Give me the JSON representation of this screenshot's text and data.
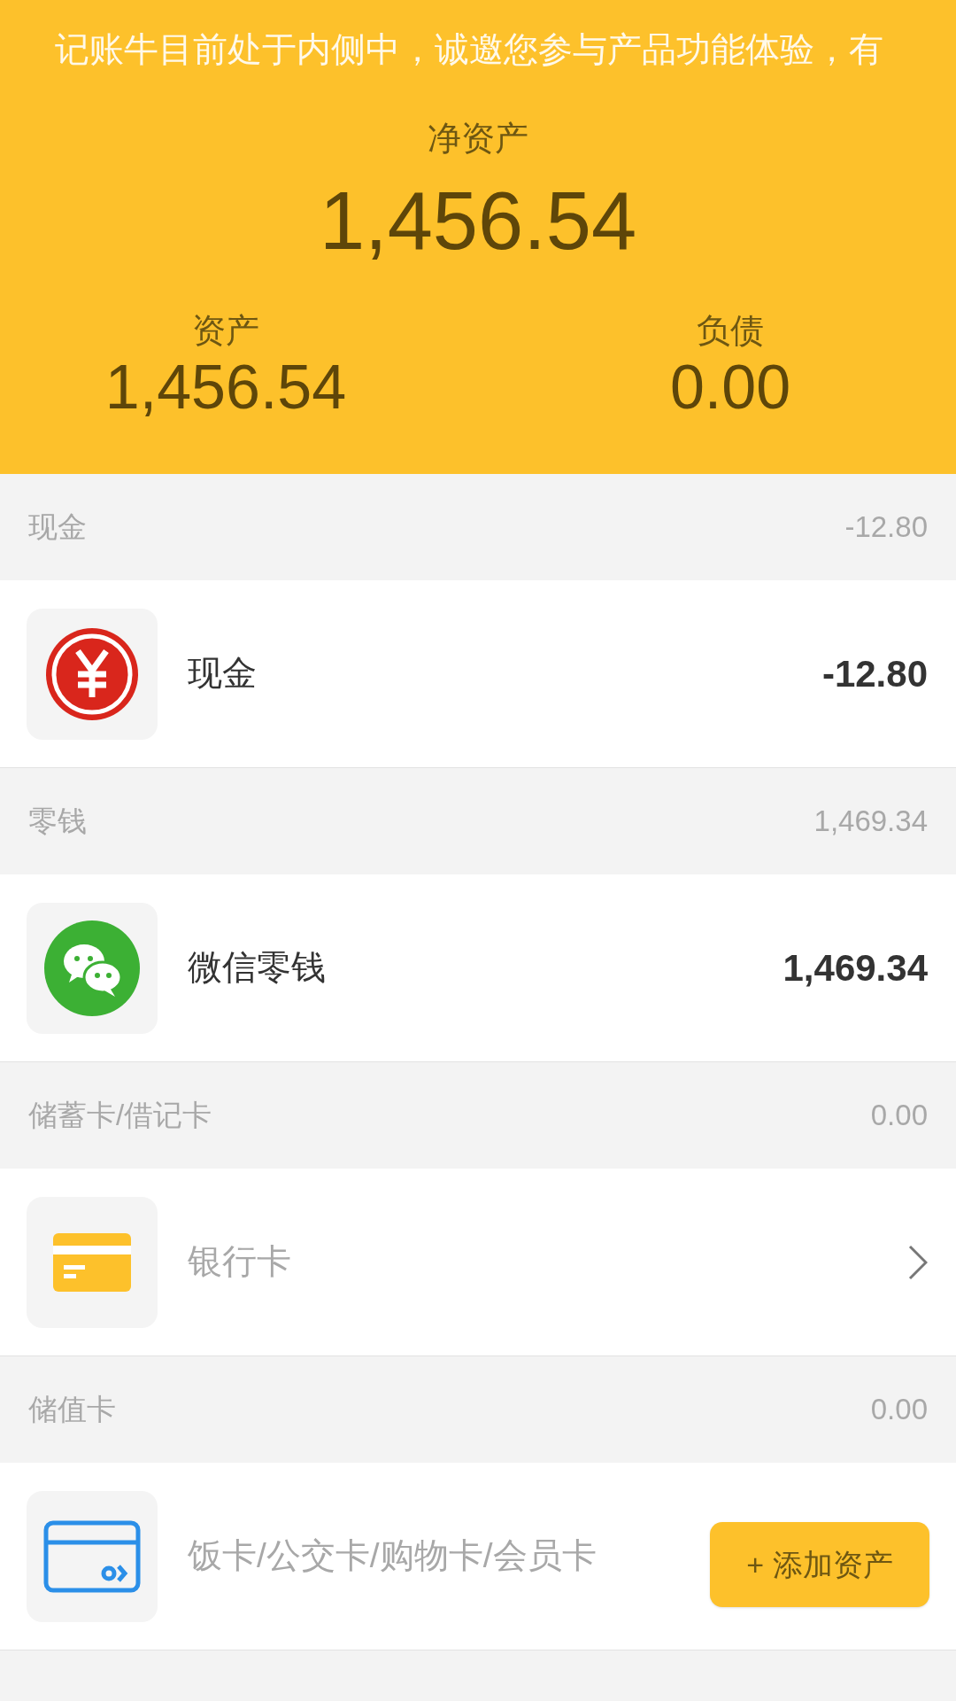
{
  "banner": "记账牛目前处于内侧中，诚邀您参与产品功能体验，有",
  "net_worth": {
    "label": "净资产",
    "value": "1,456.54"
  },
  "summary": [
    {
      "label": "资产",
      "value": "1,456.54"
    },
    {
      "label": "负债",
      "value": "0.00"
    }
  ],
  "sections": [
    {
      "title": "现金",
      "total": "-12.80",
      "row": {
        "kind": "account",
        "name": "现金",
        "amount": "-12.80"
      }
    },
    {
      "title": "零钱",
      "total": "1,469.34",
      "row": {
        "kind": "account",
        "name": "微信零钱",
        "amount": "1,469.34"
      }
    },
    {
      "title": "储蓄卡/借记卡",
      "total": "0.00",
      "row": {
        "kind": "link",
        "name": "银行卡"
      }
    },
    {
      "title": "储值卡",
      "total": "0.00",
      "row": {
        "kind": "add",
        "name": "饭卡/公交卡/购物卡/会员卡"
      }
    }
  ],
  "add_button": {
    "label": "+ 添加资产"
  }
}
